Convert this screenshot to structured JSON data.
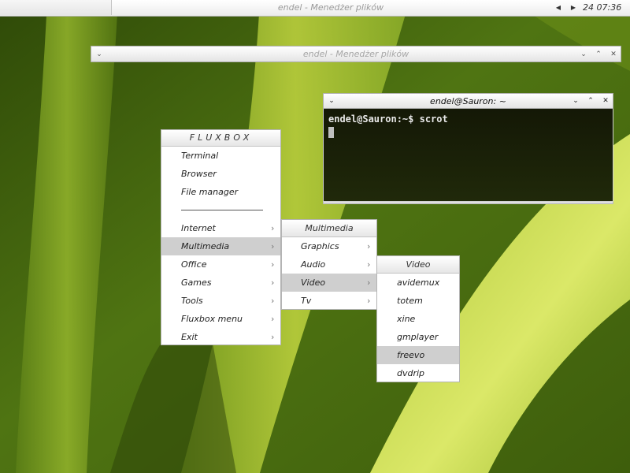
{
  "toolbar": {
    "title": "endel - Menedżer plików",
    "prev_icon": "triangle-left-icon",
    "next_icon": "triangle-right-icon",
    "clock": "24 07:36"
  },
  "file_manager_window": {
    "title": "endel - Menedżer plików",
    "buttons": [
      "shade-icon",
      "iconify-icon",
      "maximize-icon",
      "close-icon"
    ]
  },
  "terminal_window": {
    "title": "endel@Sauron: ~",
    "prompt_line": "endel@Sauron:~$ scrot",
    "buttons": [
      "shade-icon",
      "iconify-icon",
      "maximize-icon",
      "close-icon"
    ]
  },
  "root_menu": {
    "title": "FLUXBOX",
    "items": [
      {
        "label": "Terminal"
      },
      {
        "label": "Browser"
      },
      {
        "label": "File manager"
      },
      {
        "separator": true
      },
      {
        "label": "Internet",
        "submenu": true
      },
      {
        "label": "Multimedia",
        "submenu": true,
        "highlighted": true
      },
      {
        "label": "Office",
        "submenu": true
      },
      {
        "label": "Games",
        "submenu": true
      },
      {
        "label": "Tools",
        "submenu": true
      },
      {
        "label": "Fluxbox menu",
        "submenu": true
      },
      {
        "label": "Exit",
        "submenu": true
      }
    ]
  },
  "multimedia_menu": {
    "title": "Multimedia",
    "items": [
      {
        "label": "Graphics",
        "submenu": true
      },
      {
        "label": "Audio",
        "submenu": true
      },
      {
        "label": "Video",
        "submenu": true,
        "highlighted": true
      },
      {
        "label": "Tv",
        "submenu": true
      }
    ]
  },
  "video_menu": {
    "title": "Video",
    "items": [
      {
        "label": "avidemux"
      },
      {
        "label": "totem"
      },
      {
        "label": "xine"
      },
      {
        "label": "gmplayer"
      },
      {
        "label": "freevo",
        "highlighted": true
      },
      {
        "label": "dvdrip"
      }
    ]
  },
  "colors": {
    "menu_highlight": "#cfcfcf",
    "terminal_background": "#1b2208",
    "wallpaper_green": "#6e9a1c"
  }
}
